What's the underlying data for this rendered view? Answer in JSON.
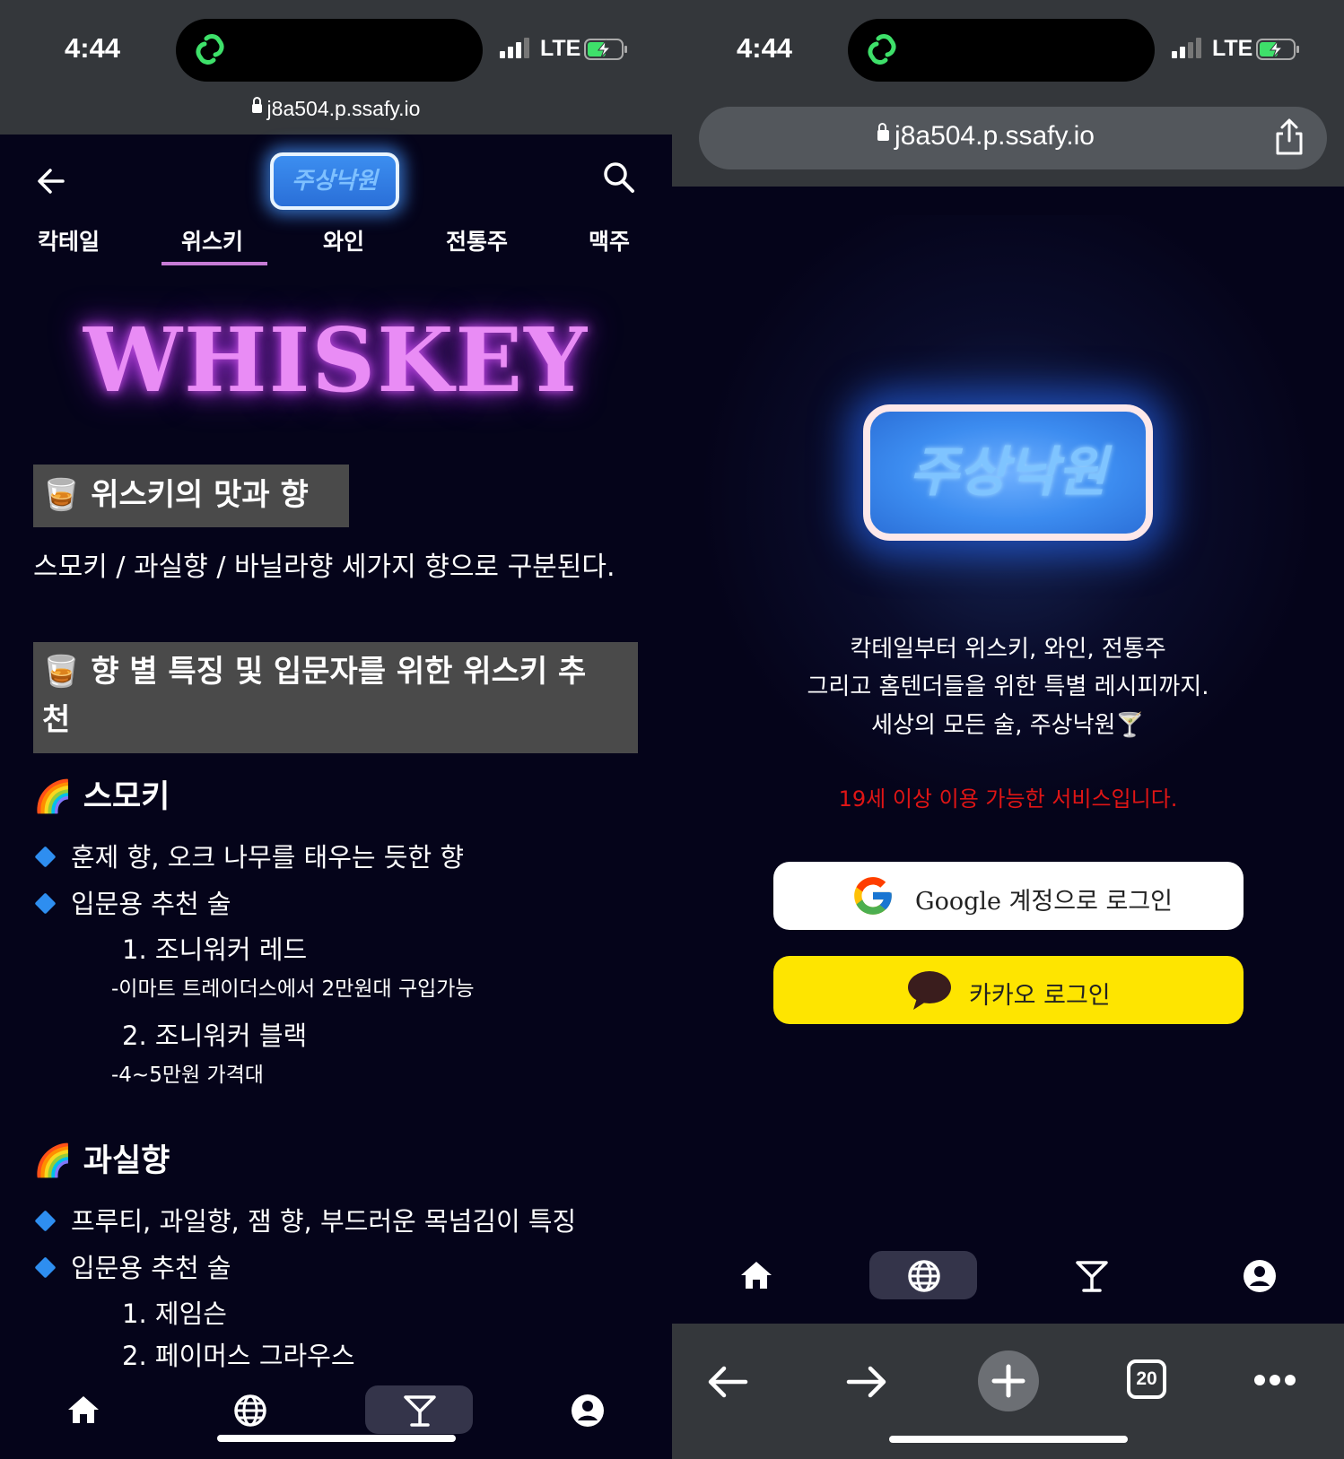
{
  "left": {
    "status": {
      "time": "4:44",
      "network": "LTE"
    },
    "url": "j8a504.p.ssafy.io",
    "logo_text": "주상낙원",
    "tabs": [
      "칵테일",
      "위스키",
      "와인",
      "전통주",
      "맥주"
    ],
    "active_tab": "위스키",
    "hero_title": "WHISKEY",
    "section1": {
      "emoji": "🥃",
      "title": "위스키의 맛과 향",
      "body": "스모키 / 과실향 / 바닐라향 세가지 향으로 구분된다."
    },
    "section2": {
      "emoji": "🥃",
      "title_line1": "향 별 특징 및 입문자를 위한 위스키 추",
      "title_line2": "천"
    },
    "smoky": {
      "emoji": "🌈",
      "title": "스모키",
      "bullets": [
        "훈제 향, 오크 나무를 태우는 듯한 향",
        "입문용 추천 술"
      ],
      "recs": [
        {
          "name": "1. 조니워커 레드",
          "note": "-이마트 트레이더스에서 2만원대 구입가능"
        },
        {
          "name": "2. 조니워커 블랙",
          "note": "-4~5만원 가격대"
        }
      ]
    },
    "fruity": {
      "emoji": "🌈",
      "title": "과실향",
      "bullets": [
        "프루티, 과일향, 잼 향, 부드러운 목넘김이 특징",
        "입문용 추천 술"
      ],
      "recs": [
        "1. 제임슨",
        "2. 페이머스 그라우스"
      ]
    },
    "nav_active": "cocktail"
  },
  "right": {
    "status": {
      "time": "4:44",
      "network": "LTE"
    },
    "url": "j8a504.p.ssafy.io",
    "logo_text": "주상낙원",
    "desc": [
      "칵테일부터 위스키, 와인, 전통주",
      "그리고 홈텐더들을 위한 특별 레시피까지.",
      "세상의 모든 술, 주상낙원🍸"
    ],
    "age_notice": "19세 이상 이용 가능한 서비스입니다.",
    "google_label": "Google 계정으로 로그인",
    "kakao_label": "카카오 로그인",
    "nav_active": "globe",
    "tab_count": "20"
  },
  "colors": {
    "accent_purple": "#e98cf5",
    "kakao_yellow": "#fee500",
    "notice_red": "#e01515",
    "logo_blue": "#3c8ef0"
  }
}
